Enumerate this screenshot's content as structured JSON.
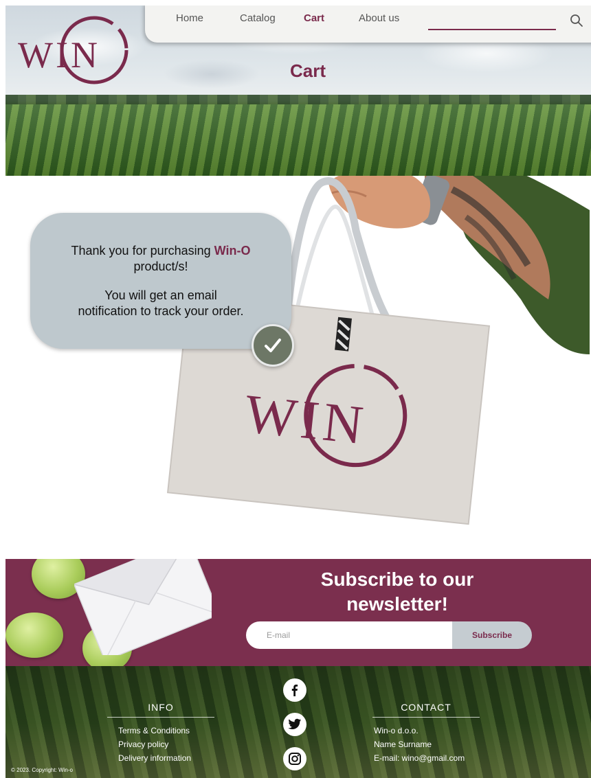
{
  "nav": {
    "items": [
      {
        "label": "Home",
        "active": false
      },
      {
        "label": "Catalog",
        "active": false
      },
      {
        "label": "Cart",
        "active": true
      },
      {
        "label": "About us",
        "active": false
      }
    ],
    "search_icon": "search-icon"
  },
  "logo": {
    "text": "WIN"
  },
  "hero": {
    "title": "Cart"
  },
  "message": {
    "line1_prefix": "Thank you for purchasing ",
    "brand": "Win-O",
    "line2": "product/s!",
    "line3": "You will get an email",
    "line4": "notification to track your order.",
    "check_icon": "checkmark-icon"
  },
  "bag": {
    "logo_text": "WIN"
  },
  "newsletter": {
    "title_line1": "Subscribe to our",
    "title_line2": "newsletter!",
    "email_placeholder": "E-mail",
    "button_label": "Subscribe"
  },
  "footer": {
    "info": {
      "heading": "Info",
      "links": [
        "Terms & Conditions",
        "Privacy policy",
        "Delivery information"
      ]
    },
    "contact": {
      "heading": "Contact",
      "lines": [
        "Win-o d.o.o.",
        "Name Surname",
        "E-mail: wino@gmail.com"
      ]
    },
    "socials": [
      "facebook-icon",
      "twitter-icon",
      "instagram-icon"
    ],
    "copyright": "© 2023. Copyright: Win-o"
  },
  "colors": {
    "brand": "#7a2a4c",
    "newsletter_bg": "#7b2f4e",
    "bubble_bg": "#bec8cd",
    "check_bg": "#6d7766"
  }
}
